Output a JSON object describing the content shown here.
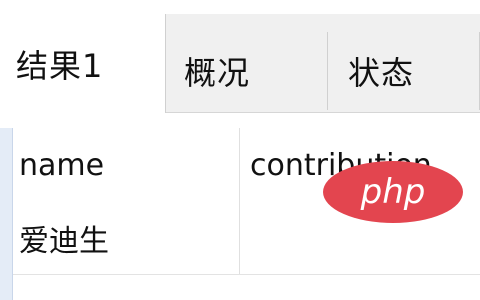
{
  "tabs": [
    {
      "label": "结果1",
      "active": true
    },
    {
      "label": "概况",
      "active": false
    },
    {
      "label": "状态",
      "active": false
    }
  ],
  "grid": {
    "columns": [
      "name",
      "contribution"
    ],
    "rows": [
      [
        "爱迪生",
        ""
      ]
    ]
  },
  "watermark": {
    "text": "php",
    "color": "#e3454f"
  },
  "colors": {
    "tab_bar": "#f0f0f0",
    "row_marker": "#e4ecf7",
    "border": "#d0d0d0"
  }
}
